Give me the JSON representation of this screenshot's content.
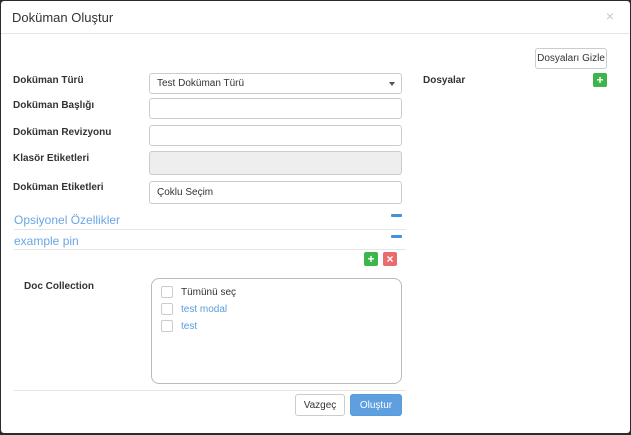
{
  "modal": {
    "title": "Doküman Oluştur",
    "close_glyph": "×"
  },
  "files_panel": {
    "toggle_button": "Dosyaları Gizle",
    "label": "Dosyalar",
    "add_glyph": "+"
  },
  "form": {
    "doc_type_label": "Doküman Türü",
    "doc_type_value": "Test Doküman Türü",
    "doc_title_label": "Doküman Başlığı",
    "doc_title_value": "",
    "doc_revision_label": "Doküman Revizyonu",
    "doc_revision_value": "",
    "folder_tags_label": "Klasör Etiketleri",
    "doc_tags_label": "Doküman Etiketleri",
    "doc_tags_value": "Çoklu Seçim"
  },
  "sections": [
    {
      "title": "Opsiyonel Özellikler"
    },
    {
      "title": "example pin"
    }
  ],
  "pin_actions": {
    "add_glyph": "+",
    "remove_glyph": "×"
  },
  "doc_collection": {
    "label": "Doc Collection",
    "items": [
      {
        "label": "Tümünü seç",
        "checked": false
      },
      {
        "label": "test modal",
        "checked": false
      },
      {
        "label": "test",
        "checked": false
      }
    ]
  },
  "footer": {
    "cancel": "Vazgeç",
    "submit": "Oluştur"
  },
  "colors": {
    "accent": "#5e9fe0",
    "add": "#3cb54a",
    "remove": "#e96b6b",
    "section_text": "#6aa6e3"
  }
}
